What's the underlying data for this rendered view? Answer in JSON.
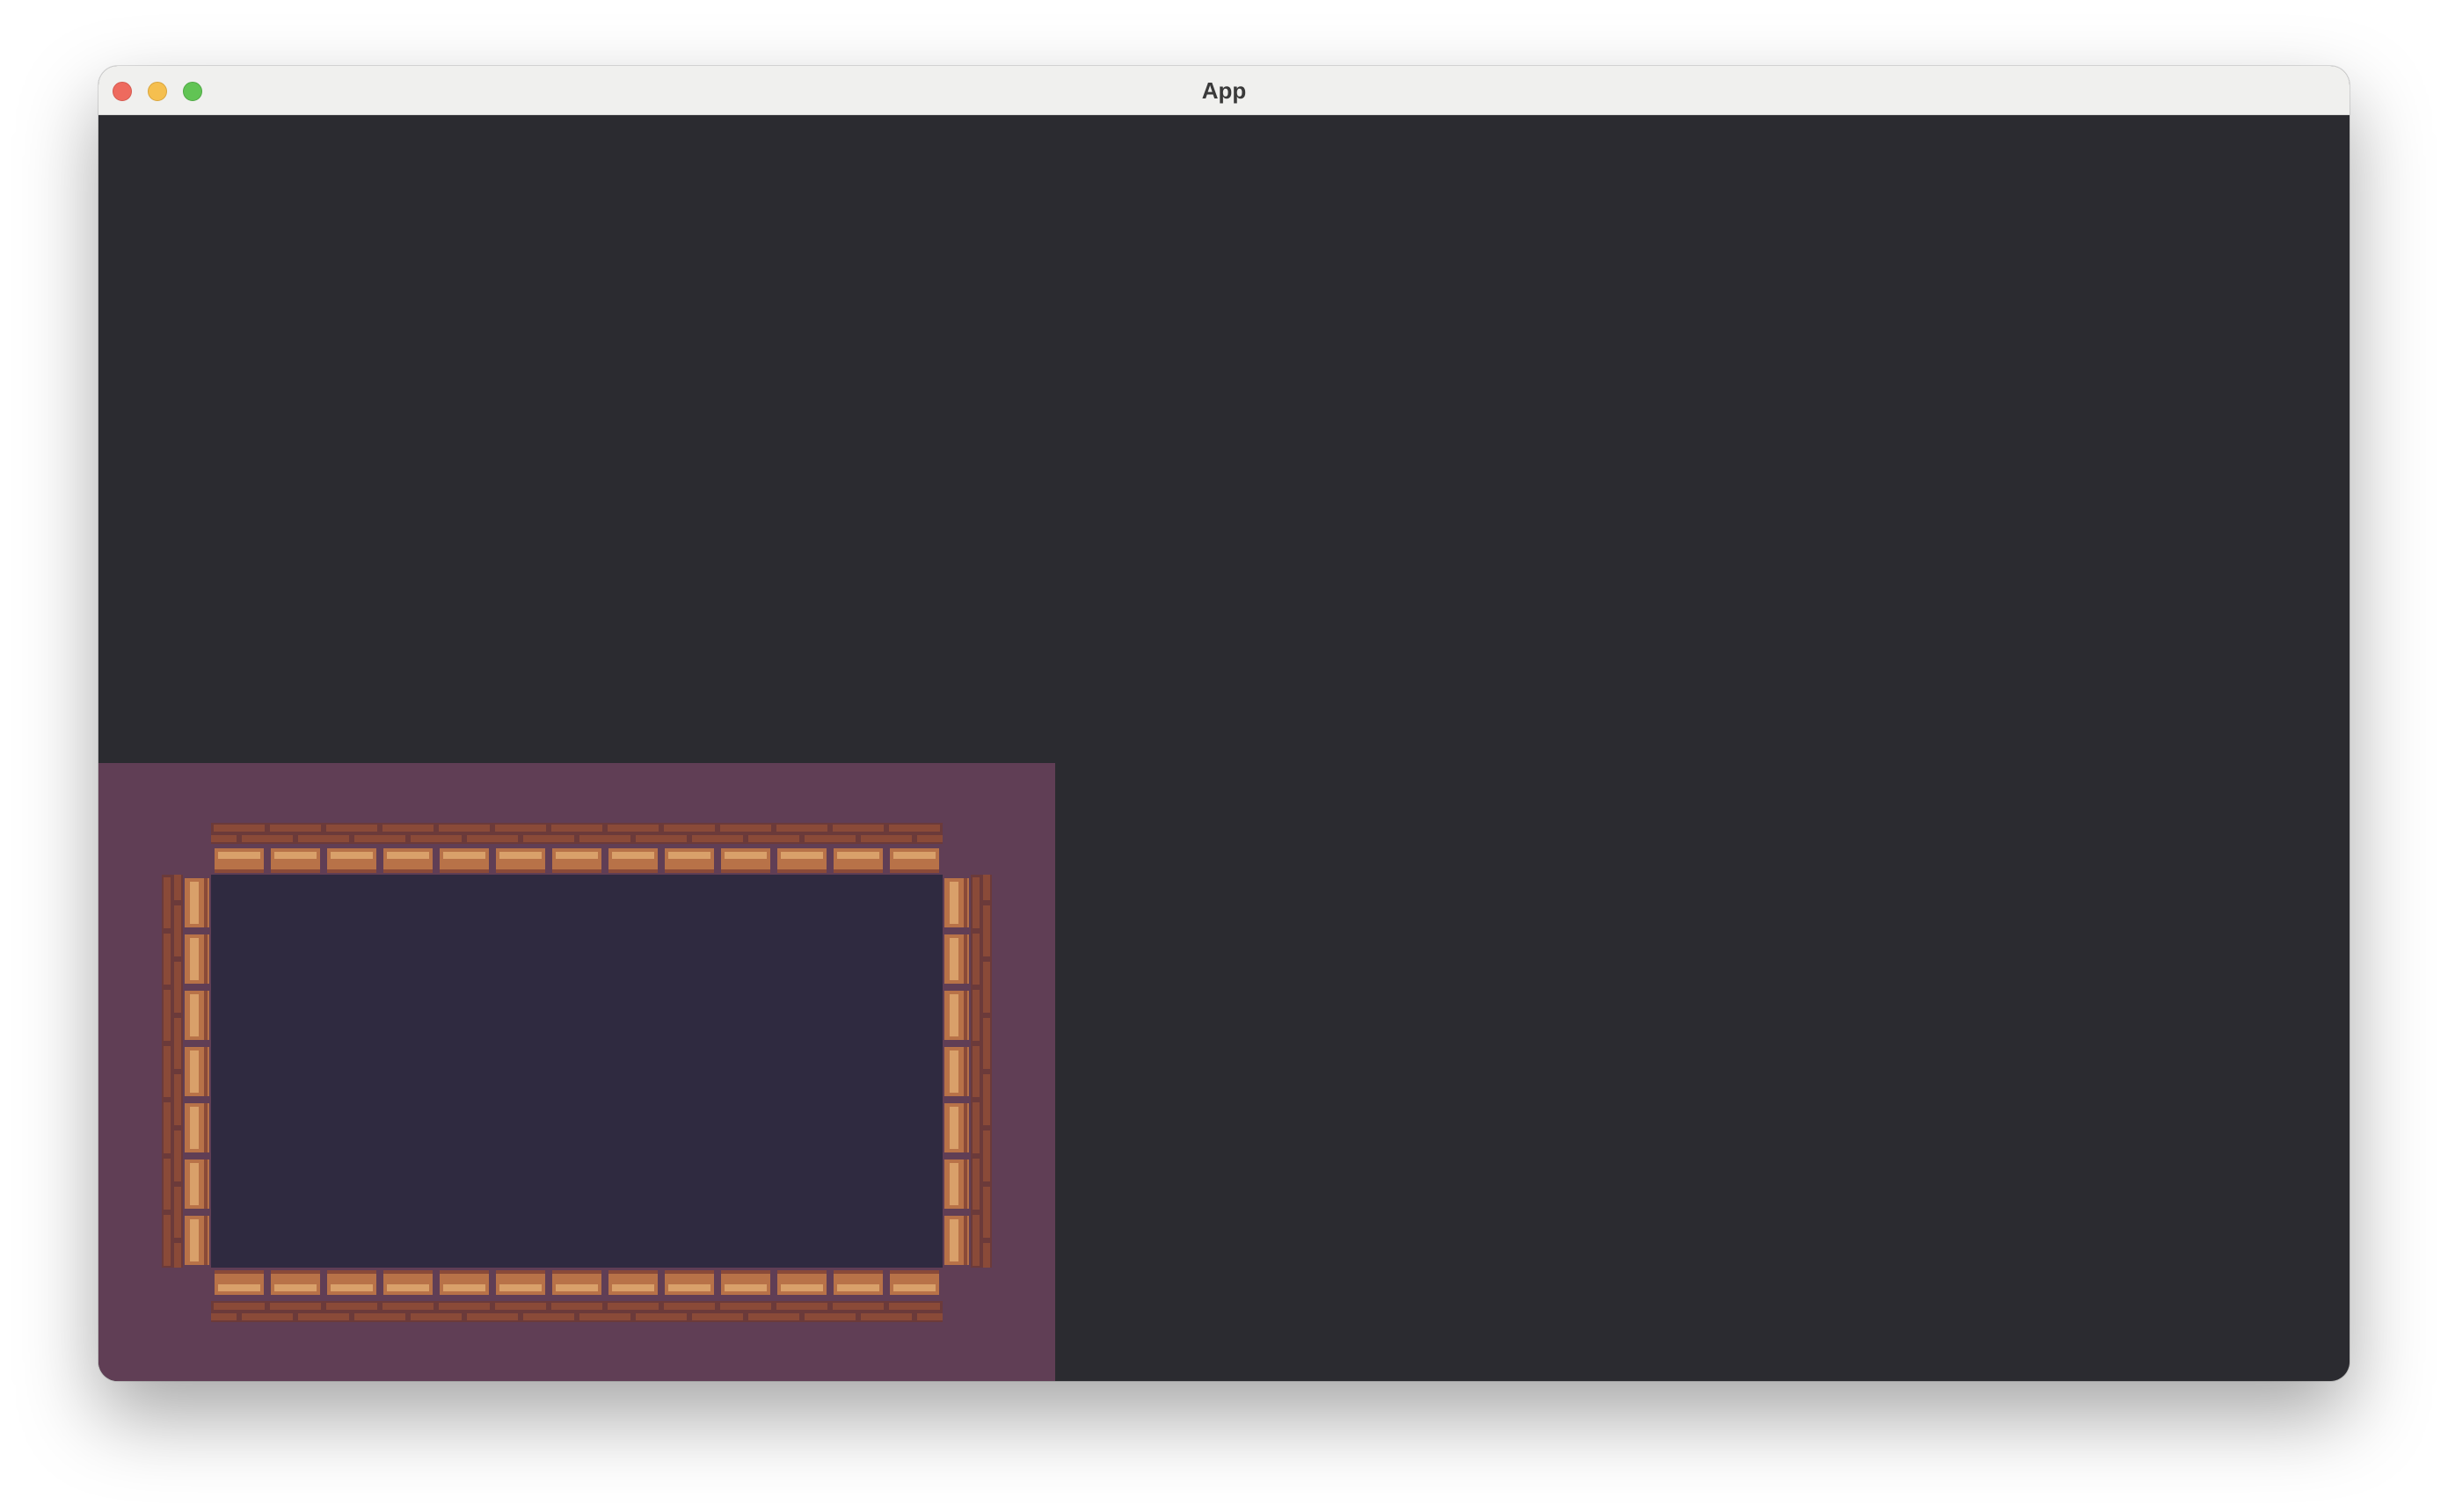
{
  "window": {
    "title": "App"
  },
  "colors": {
    "desktop": "#ffffff",
    "titlebar": "#f0f0ee",
    "app_background": "#2b2b30",
    "game_background": "#603e55",
    "room_floor": "#2f2a40",
    "brick_light": "#d9a06a",
    "brick_mid": "#b87248",
    "brick_dark": "#8a4a38",
    "mortar": "#6b3a3a"
  },
  "icons": {
    "close": "close-icon",
    "minimize": "minimize-icon",
    "zoom": "zoom-icon"
  },
  "game": {
    "scene": "room-with-brick-walls"
  }
}
